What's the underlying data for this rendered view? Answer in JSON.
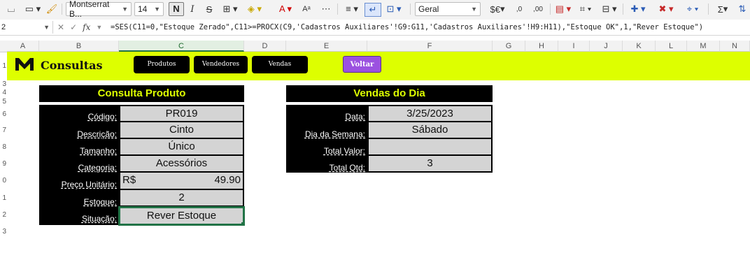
{
  "ribbon": {
    "font_name": "Montserrat B...",
    "font_size": "14",
    "bold_label": "N",
    "italic_label": "I",
    "strike_label": "S",
    "number_format": "Geral",
    "currency_label": "$€",
    "dec_inc": ",0",
    "dec_dec": ",00",
    "sum_label": "Σ"
  },
  "formula_bar": {
    "name_box": "2",
    "fx_label": "fx",
    "formula": "=SES(C11=0,\"Estoque Zerado\",C11>=PROCX(C9,'Cadastros Auxiliares'!G9:G11,'Cadastros Auxiliares'!H9:H11),\"Estoque OK\",1,\"Rever Estoque\")"
  },
  "columns": [
    "A",
    "B",
    "C",
    "D",
    "E",
    "F",
    "G",
    "H",
    "I",
    "J",
    "K",
    "L",
    "M",
    "N"
  ],
  "rows": [
    "1",
    "3",
    "4",
    "5",
    "6",
    "7",
    "8",
    "9",
    "0",
    "1",
    "2",
    "3"
  ],
  "banner": {
    "title": "Consultas",
    "nav": [
      "Produtos",
      "Vendedores",
      "Vendas"
    ],
    "voltar": "Voltar",
    "accent": "#ddff00",
    "voltar_color": "#9b51e0"
  },
  "produto": {
    "title": "Consulta Produto",
    "fields": [
      {
        "label": "Código:",
        "value": "PR019"
      },
      {
        "label": "Descrição:",
        "value": "Cinto"
      },
      {
        "label": "Tamanho:",
        "value": "Único"
      },
      {
        "label": "Categoria:",
        "value": "Acessórios"
      },
      {
        "label": "Preço Unitário:",
        "currency": "R$",
        "value": "49.90"
      },
      {
        "label": "Estoque:",
        "value": "2"
      },
      {
        "label": "Situação:",
        "value": "Rever Estoque"
      }
    ]
  },
  "vendas": {
    "title": "Vendas do Dia",
    "fields": [
      {
        "label": "Data:",
        "value": "3/25/2023"
      },
      {
        "label": "Dia da Semana:",
        "value": "Sábado"
      },
      {
        "label": "Total Valor:",
        "value": ""
      },
      {
        "label": "Total Qtd:",
        "value": "3"
      }
    ]
  }
}
